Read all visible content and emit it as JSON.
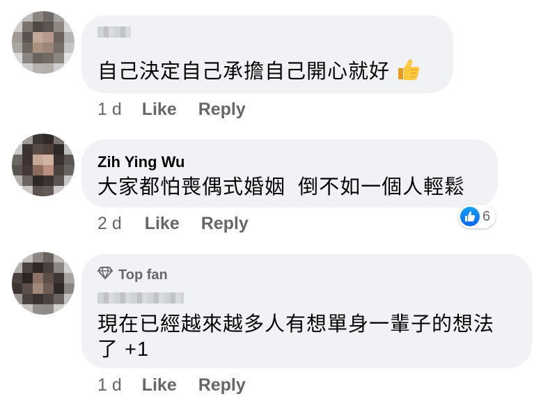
{
  "comments": [
    {
      "author": "",
      "author_blurred": true,
      "top_fan": false,
      "text": "自己決定自己承擔自己開心就好",
      "emoji": "thumbs-up-emoji",
      "time": "1 d",
      "like_label": "Like",
      "reply_label": "Reply"
    },
    {
      "author": "Zih Ying Wu",
      "author_blurred": false,
      "top_fan": false,
      "text": "大家都怕喪偶式婚姻  倒不如一個人輕鬆",
      "time": "2 d",
      "like_label": "Like",
      "reply_label": "Reply",
      "reaction": {
        "icon": "like-icon",
        "count": "6"
      }
    },
    {
      "author": "",
      "author_blurred": true,
      "top_fan": true,
      "top_fan_label": "Top fan",
      "text_line1": "現在已經越來越多人有想單身一輩子的想法",
      "text_line2": "了 +1",
      "time": "1 d",
      "like_label": "Like",
      "reply_label": "Reply"
    }
  ],
  "colors": {
    "bubble": "#f0f2f5",
    "meta_text": "#65676b",
    "like_blue": "#0866ff"
  }
}
